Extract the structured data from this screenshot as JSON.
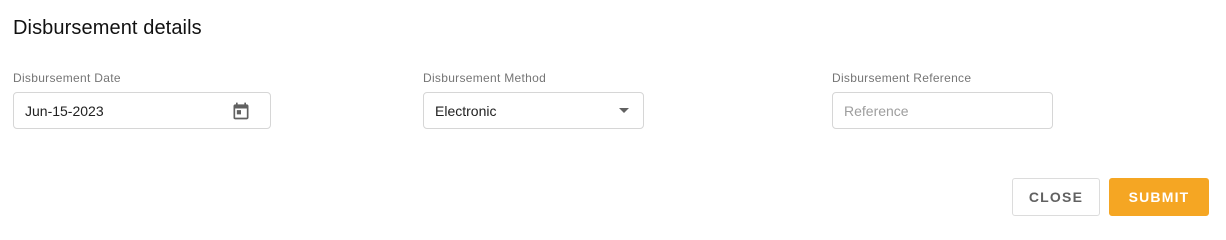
{
  "dialog": {
    "title": "Disbursement details"
  },
  "fields": {
    "date": {
      "label": "Disbursement Date",
      "value": "Jun-15-2023",
      "icon": "calendar-icon"
    },
    "method": {
      "label": "Disbursement Method",
      "value": "Electronic",
      "icon": "caret-down-icon"
    },
    "reference": {
      "label": "Disbursement Reference",
      "value": "",
      "placeholder": "Reference"
    }
  },
  "actions": {
    "close_label": "CLOSE",
    "submit_label": "SUBMIT"
  },
  "colors": {
    "accent": "#f5a623",
    "border": "#d6d6d6",
    "label": "#757575"
  }
}
